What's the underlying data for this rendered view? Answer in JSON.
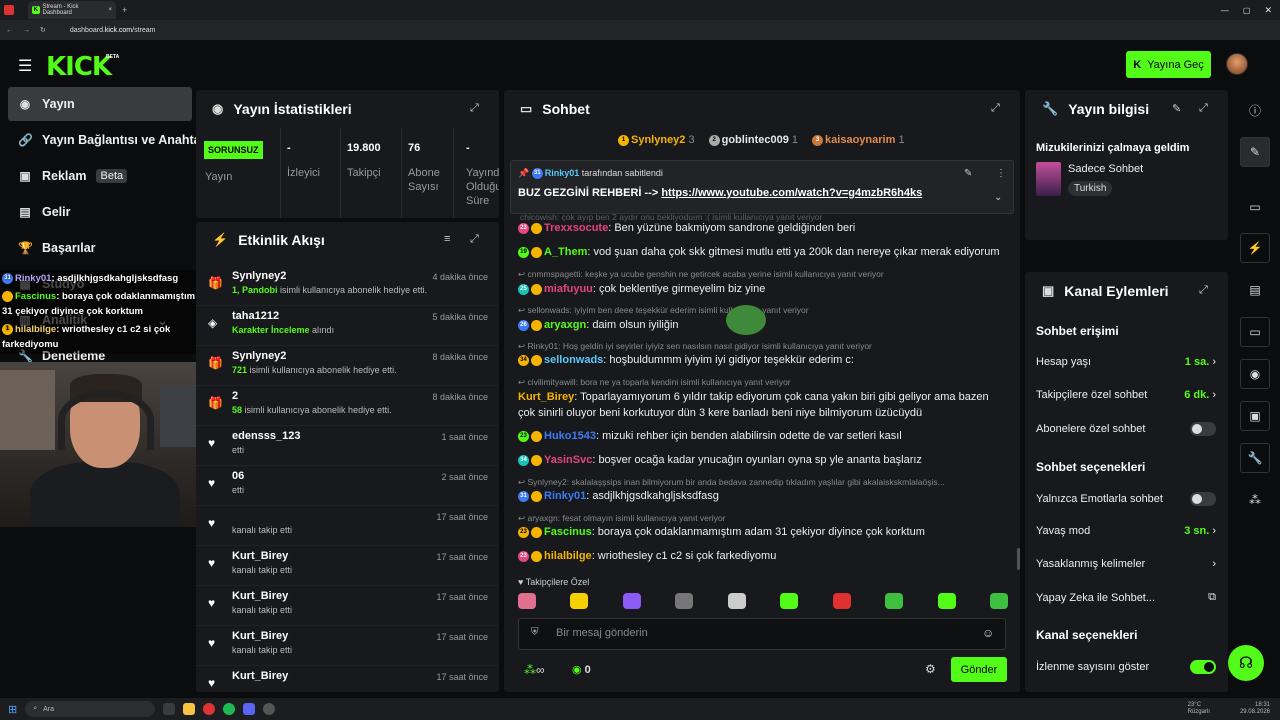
{
  "browser": {
    "tab_title": "Stream - Kick Dashboard",
    "url_prefix": "dashboard.",
    "url_domain": "kick.com",
    "url_path": "/stream"
  },
  "header": {
    "logo": "KICK",
    "logo_badge": "BETA",
    "go_live": "Yayına Geç"
  },
  "nav": {
    "items": [
      {
        "label": "Yayın"
      },
      {
        "label": "Yayın Bağlantısı ve Anahtarı"
      },
      {
        "label": "Reklam",
        "badge": "Beta"
      },
      {
        "label": "Gelir"
      },
      {
        "label": "Başarılar"
      },
      {
        "label": "Stüdyo"
      },
      {
        "label": "Analitik"
      },
      {
        "label": "Denetleme"
      }
    ]
  },
  "overlay_chat": [
    {
      "user": "Rinky01",
      "text": ": asdjlkhjgsdkahgljsksdfasg"
    },
    {
      "user": "Fascinus",
      "text": ": boraya çok odaklanmamıştım adam"
    },
    {
      "user": "",
      "text": "31 çekiyor diyince çok korktum"
    },
    {
      "user": "hilalbilge",
      "text": ": wriothesley c1 c2 si çok"
    },
    {
      "user": "",
      "text": "farkediyomu"
    }
  ],
  "stats": {
    "title": "Yayın İstatistikleri",
    "status": "SORUNSUZ",
    "status_label": "Yayın",
    "items": [
      {
        "value": "-",
        "label": "İzleyici"
      },
      {
        "value": "19.800",
        "label": "Takipçi"
      },
      {
        "value": "76",
        "label": "Abone Sayısı"
      },
      {
        "value": "-",
        "label": "Yayında Olduğu Süre"
      }
    ]
  },
  "activity": {
    "title": "Etkinlik Akışı",
    "items": [
      {
        "name": "Synlyney2",
        "desc_hl": "1, Pandobi",
        "desc": " isimli kullanıcıya abonelik hediye etti.",
        "time": "4 dakika önce",
        "icon": "gift"
      },
      {
        "name": "taha1212",
        "desc_hl": "Karakter İnceleme",
        "desc": " alındı",
        "time": "5 dakika önce",
        "icon": "points"
      },
      {
        "name": "Synlyney2",
        "desc_hl": "721",
        "desc": " isimli kullanıcıya abonelik hediye etti.",
        "time": "8 dakika önce",
        "icon": "gift"
      },
      {
        "name": "2",
        "desc_hl": "58",
        "desc": " isimli kullanıcıya abonelik hediye etti.",
        "time": "8 dakika önce",
        "icon": "gift"
      },
      {
        "name": "edensss_123",
        "desc_hl": "",
        "desc": "etti",
        "time": "1 saat önce",
        "icon": "heart"
      },
      {
        "name": "06",
        "desc_hl": "",
        "desc": "etti",
        "time": "2 saat önce",
        "icon": "heart"
      },
      {
        "name": "",
        "desc_hl": "",
        "desc": "kanalı takip etti",
        "time": "17 saat önce",
        "icon": "heart"
      },
      {
        "name": "Kurt_Birey",
        "desc_hl": "",
        "desc": "kanalı takip etti",
        "time": "17 saat önce",
        "icon": "heart"
      },
      {
        "name": "Kurt_Birey",
        "desc_hl": "",
        "desc": "kanalı takip etti",
        "time": "17 saat önce",
        "icon": "heart"
      },
      {
        "name": "Kurt_Birey",
        "desc_hl": "",
        "desc": "kanalı takip etti",
        "time": "17 saat önce",
        "icon": "heart"
      },
      {
        "name": "Kurt_Birey",
        "desc_hl": "",
        "desc": "",
        "time": "17 saat önce",
        "icon": "heart"
      }
    ]
  },
  "chat": {
    "title": "Sohbet",
    "top_gifters": [
      {
        "rank": "1",
        "name": "Synlyney2",
        "count": "3"
      },
      {
        "rank": "2",
        "name": "goblintec009",
        "count": "1"
      },
      {
        "rank": "3",
        "name": "kaisaoynarim",
        "count": "1"
      }
    ],
    "pinned": {
      "by": "Rinky01",
      "by_suffix": "tarafından sabitlendi",
      "text": "BUZ GEZGİNİ REHBERİ -->",
      "link": "https://www.youtube.com/watch?v=g4mzbR6h4ks"
    },
    "faded_reply": "chicowish: çok ayıp ben 2 aydır onu bekliyoduım :( isimli kullanıcıya yanıt veriyor",
    "messages": [
      {
        "reply": "",
        "badges": "23",
        "user": "Trexxsocute",
        "color": "#e5457a",
        "text": ": Ben yüzüne bakmiyom sandrone geldiğinden beri"
      },
      {
        "reply": "",
        "badges": "19",
        "user": "A_Them",
        "color": "#53fc18",
        "text": ": vod şuan daha çok skk gitmesi mutlu etti ya 200k dan nereye çıkar merak ediyorum"
      },
      {
        "reply": "cnmmspagetti: keşke ya ucube genshin ne getircek acaba yerine isimli kullanıcıya yanıt veriyor",
        "badges": "25",
        "user": "miafuyuu",
        "color": "#e5457a",
        "text": ": çok beklentiye girmeyelim biz yine"
      },
      {
        "reply": "sellonwads: iyiyim ben deee teşekkür ederim  isimli kullanıcıya yanıt veriyor",
        "badges": "26",
        "user": "aryaxgn",
        "color": "#53fc18",
        "text": ": daim olsun iyiliğin"
      },
      {
        "reply": "Rinky01: Hoş geldin iyi seyirler iyiyiz sen nasılsın nasıl gidiyor isimli kullanıcıya yanıt veriyor",
        "badges": "34",
        "user": "sellonwads",
        "color": "#5ac8fa",
        "text": ": hoşbuldummm iyiyim iyi gidiyor teşekkür ederim c:"
      },
      {
        "reply": "civilimityawill: bora ne ya toparla kendini isimli kullanıcıya yanıt veriyor",
        "badges": "",
        "user": "Kurt_Birey",
        "color": "#f5b400",
        "text": ": Toparlayamıyorum 6 yıldır takip ediyorum çok cana yakın biri gibi geliyor ama bazen",
        "cont": "çok sinirli oluyor beni korkutuyor dün 3 kere banladı beni niye bilmiyorum üzücüydü"
      },
      {
        "reply": "",
        "badges": "23",
        "user": "Huko1543",
        "color": "#3d7bf5",
        "text": ": mizuki rehber için benden alabilirsin odette de var setleri kasıl"
      },
      {
        "reply": "",
        "badges": "34",
        "user": "YasinSvc",
        "color": "#e5457a",
        "text": ": boşver ocağa kadar ynucağın oyunları oyna sp yle ananta başlarız"
      },
      {
        "reply": "Synlyney2: skalalaşşsips inan bilmiyorum bir anda bedava zannedip tıkladım yaşlılar gibi akalaiskskmlalaöşis...",
        "badges": "31",
        "user": "Rinky01",
        "color": "#3d7bf5",
        "text": ": asdjlkhjgsdkahgljsksdfasg"
      },
      {
        "reply": "aryaxgn: fesat olmayın isimli kullanıcıya yanıt veriyor",
        "badges": "23",
        "user": "Fascinus",
        "color": "#53fc18",
        "text": ": boraya çok odaklanmamıştım adam 31 çekiyor diyince çok korktum"
      },
      {
        "reply": "",
        "badges": "23",
        "user": "hilalbilge",
        "color": "#f5b400",
        "text": ": wriothesley c1 c2 si çok farkediyomu"
      }
    ],
    "emote_section": "Takipçilere Özel",
    "input_placeholder": "Bir mesaj gönderin",
    "points_value": "0",
    "send": "Gönder"
  },
  "stream_info": {
    "title": "Yayın bilgisi",
    "stream_title": "Mizukilerinizi çalmaya geldim",
    "category": "Sadece Sohbet",
    "language": "Turkish"
  },
  "channel_actions": {
    "title": "Kanal Eylemleri",
    "chat_access": "Sohbet erişimi",
    "account_age": {
      "label": "Hesap yaşı",
      "value": "1 sa."
    },
    "followers_only": {
      "label": "Takipçilere özel sohbet",
      "value": "6 dk."
    },
    "subs_only": {
      "label": "Abonelere özel sohbet"
    },
    "chat_options": "Sohbet seçenekleri",
    "emote_only": {
      "label": "Yalnızca Emotlarla sohbet"
    },
    "slow_mode": {
      "label": "Yavaş mod",
      "value": "3 sn."
    },
    "banned_words": {
      "label": "Yasaklanmış kelimeler"
    },
    "ai_chat": {
      "label": "Yapay Zeka ile Sohbet..."
    },
    "channel_options": "Kanal seçenekleri",
    "show_viewers": {
      "label": "İzlenme sayısını göster"
    }
  },
  "taskbar": {
    "search": "Ara",
    "weather": "23°C",
    "weather_desc": "Rüzgarlı",
    "time": "18:31",
    "date": "29.08.2026"
  },
  "colors": {
    "accent": "#53fc18",
    "panel": "#18191c",
    "bg": "#0b0c0e"
  }
}
